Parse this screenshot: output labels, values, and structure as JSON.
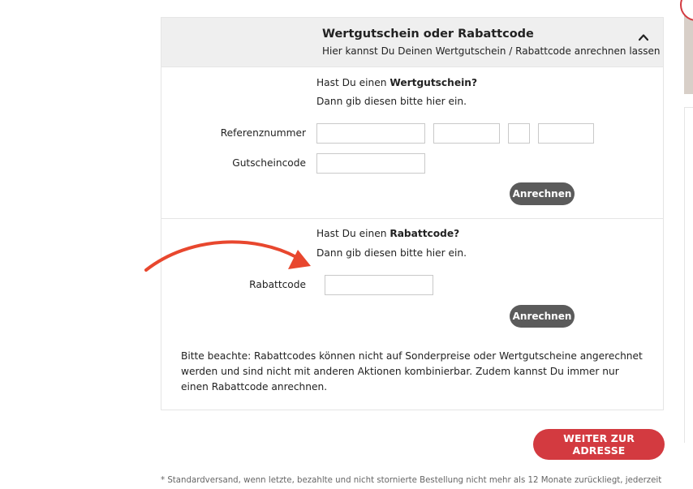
{
  "voucher_panel": {
    "title": "Wertgutschein oder Rabattcode",
    "subtitle": "Hier kannst Du Deinen Wertgutschein / Rabattcode anrechnen lassen",
    "gift_card": {
      "question_prefix": "Hast Du einen ",
      "question_bold": "Wertgutschein?",
      "instruction": "Dann gib diesen bitte hier ein.",
      "reference_label": "Referenznummer",
      "code_label": "Gutscheincode",
      "reference_values": [
        "",
        "",
        "",
        ""
      ],
      "code_value": "",
      "submit_label": "Anrechnen"
    },
    "discount": {
      "question_prefix": "Hast Du einen ",
      "question_bold": "Rabattcode?",
      "instruction": "Dann gib diesen bitte hier ein.",
      "code_label": "Rabattcode",
      "code_value": "",
      "submit_label": "Anrechnen"
    },
    "note": "Bitte beachte: Rabattcodes können nicht auf Sonderpreise oder Wertgutscheine angerechnet werden und sind nicht mit anderen Aktionen kombinierbar. Zudem kannst Du immer nur einen Rabattcode anrechnen."
  },
  "continue_button": "WEITER ZUR ADRESSE",
  "footnote": "* Standardversand, wenn letzte, bezahlte und nicht stornierte Bestellung nicht mehr als 12 Monate zurückliegt, jederzeit",
  "icons": {
    "collapse": "chevron-up-icon",
    "annotation": "red-arrow"
  },
  "colors": {
    "accent": "#d33a40",
    "button_dark": "#5b5b5b",
    "header_bg": "#efefef",
    "arrow": "#e8472e"
  }
}
